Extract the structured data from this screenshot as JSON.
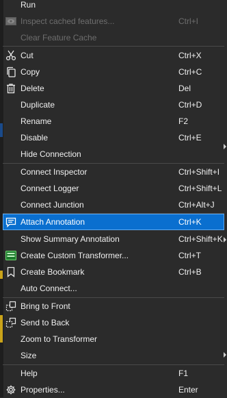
{
  "menu": {
    "run": {
      "label": "Run"
    },
    "inspect_cached": {
      "label": "Inspect cached features...",
      "shortcut": "Ctrl+I"
    },
    "clear_cache": {
      "label": "Clear Feature Cache"
    },
    "cut": {
      "label": "Cut",
      "shortcut": "Ctrl+X"
    },
    "copy": {
      "label": "Copy",
      "shortcut": "Ctrl+C"
    },
    "delete": {
      "label": "Delete",
      "shortcut": "Del"
    },
    "duplicate": {
      "label": "Duplicate",
      "shortcut": "Ctrl+D"
    },
    "rename": {
      "label": "Rename",
      "shortcut": "F2"
    },
    "disable": {
      "label": "Disable",
      "shortcut": "Ctrl+E"
    },
    "hide_connection": {
      "label": "Hide Connection"
    },
    "connect_inspector": {
      "label": "Connect Inspector",
      "shortcut": "Ctrl+Shift+I"
    },
    "connect_logger": {
      "label": "Connect Logger",
      "shortcut": "Ctrl+Shift+L"
    },
    "connect_junction": {
      "label": "Connect Junction",
      "shortcut": "Ctrl+Alt+J"
    },
    "attach_annotation": {
      "label": "Attach Annotation",
      "shortcut": "Ctrl+K"
    },
    "show_summary_annotation": {
      "label": "Show Summary Annotation",
      "shortcut": "Ctrl+Shift+K"
    },
    "create_custom_transformer": {
      "label": "Create Custom Transformer...",
      "shortcut": "Ctrl+T"
    },
    "create_bookmark": {
      "label": "Create Bookmark",
      "shortcut": "Ctrl+B"
    },
    "auto_connect": {
      "label": "Auto Connect..."
    },
    "bring_to_front": {
      "label": "Bring to Front"
    },
    "send_to_back": {
      "label": "Send to Back"
    },
    "zoom_to_transformer": {
      "label": "Zoom to Transformer"
    },
    "size": {
      "label": "Size"
    },
    "help": {
      "label": "Help",
      "shortcut": "F1"
    },
    "properties": {
      "label": "Properties...",
      "shortcut": "Enter"
    }
  },
  "colors": {
    "background": "#2b2b2b",
    "selected": "#0a6fcf",
    "text": "#f0f0f0",
    "disabled_text": "#6e6e6e",
    "separator": "#4a4a4a"
  }
}
